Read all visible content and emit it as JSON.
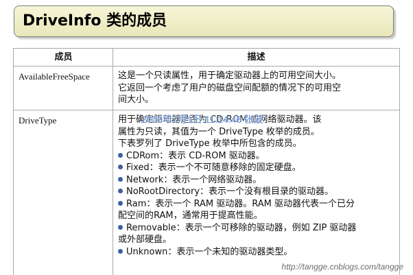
{
  "header": {
    "title": "DriveInfo 类的成员"
  },
  "table": {
    "columns": [
      "成员",
      "描述"
    ],
    "rows": [
      {
        "name": "AvailableFreeSpace",
        "lines": [
          "这是一个只读属性，用于确定驱动器上的可用空间大小。",
          "它返回一个考虑了用户的磁盘空间配额的情况下的可用空",
          "间大小。"
        ]
      },
      {
        "name": "DriveType",
        "lines": [
          "用于确定驱动器是否为 CD-ROM 或网络驱动器。该",
          "属性为只读，其值为一个 DriveType 枚举的成员。",
          "下表罗列了 DriveType 枚举中所包含的成员。"
        ],
        "bullets": [
          [
            "CDRom：表示 CD-ROM 驱动器。"
          ],
          [
            "Fixed：表示一个不可随意移除的固定硬盘。"
          ],
          [
            "Network：表示一个网络驱动器。"
          ],
          [
            "NoRootDirectory：表示一个没有根目录的驱动器。"
          ],
          [
            "Ram：表示一个 RAM 驱动器。RAM 驱动器代表一个已分",
            "配空间的RAM，通常用于提高性能。"
          ],
          [
            "Removable：表示一个可移除的驱动器，例如 ZIP 驱动器",
            "或外部硬盘。"
          ],
          [
            "Unknown：表示一个未知的驱动器类型。"
          ]
        ]
      }
    ]
  },
  "overlay": {
    "timestamp": "2009年7月1日 11:14:46 张波",
    "site": "http://tangge.cnblogs.com/tangge"
  },
  "colors": {
    "header_bg_top": "#f6f6d8",
    "header_bg_bottom": "#e8e7b9",
    "bullet": "#3d5f9c",
    "stamp": "#4f86d9"
  }
}
